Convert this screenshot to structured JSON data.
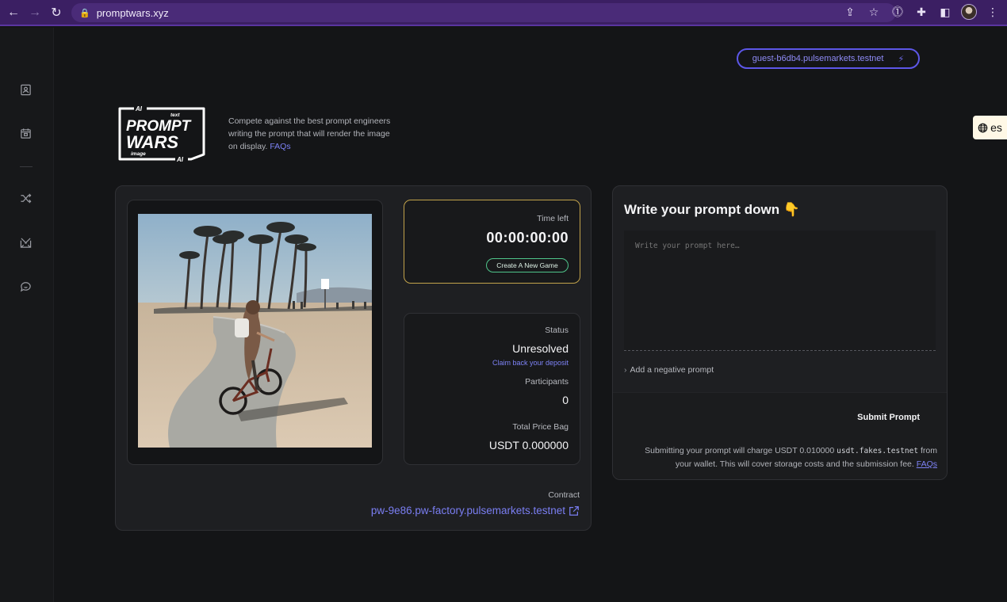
{
  "browser": {
    "url": "promptwars.xyz"
  },
  "header": {
    "account": "guest-b6db4.pulsemarkets.testnet",
    "language": "es"
  },
  "logo": {
    "line1": "PROMPT",
    "line2": "WARS",
    "ai_top": "AI",
    "text_small": "text",
    "image_small": "image",
    "ai_bottom": "AI"
  },
  "intro": {
    "text": "Compete against the best prompt engineers writing the prompt that will render the image on display.",
    "faq_link": "FAQs"
  },
  "game": {
    "time_left_label": "Time left",
    "time_left_value": "00:00:00:00",
    "create_button": "Create A New Game",
    "status_label": "Status",
    "status_value": "Unresolved",
    "claim_link": "Claim back your deposit",
    "participants_label": "Participants",
    "participants_value": "0",
    "price_label": "Total Price Bag",
    "price_value": "USDT 0.000000",
    "contract_label": "Contract",
    "contract_value": "pw-9e86.pw-factory.pulsemarkets.testnet"
  },
  "prompt": {
    "title": "Write your prompt down 👇",
    "placeholder": "Write your prompt here…",
    "negative_prompt": "Add a negative prompt",
    "submit_button": "Submit Prompt",
    "note_before": "Submitting your prompt will charge USDT 0.010000 ",
    "note_code": "usdt.fakes.testnet",
    "note_after": " from your wallet. This will cover storage costs and the submission fee. ",
    "note_link": "FAQs"
  },
  "colors": {
    "accent": "#7d82f5",
    "time_border": "#c2a34b",
    "create_border": "#4fc48a",
    "chrome": "#3b1f63"
  }
}
